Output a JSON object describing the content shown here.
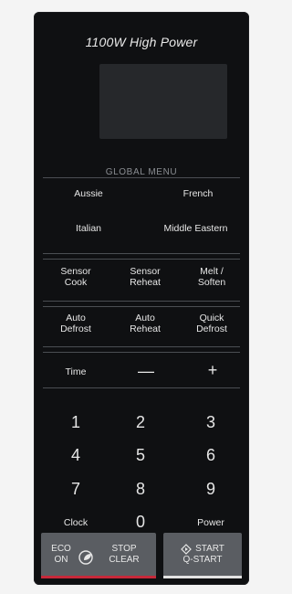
{
  "panel": {
    "power_label": "1100W High Power",
    "global_menu_title": "GLOBAL MENU",
    "global_menu_items": [
      "Aussie",
      "French",
      "Italian",
      "Middle Eastern"
    ],
    "sensor_row": [
      {
        "line1": "Sensor",
        "line2": "Cook"
      },
      {
        "line1": "Sensor",
        "line2": "Reheat"
      },
      {
        "line1": "Melt /",
        "line2": "Soften"
      }
    ],
    "defrost_row": [
      {
        "line1": "Auto",
        "line2": "Defrost"
      },
      {
        "line1": "Auto",
        "line2": "Reheat"
      },
      {
        "line1": "Quick",
        "line2": "Defrost"
      }
    ],
    "time_label": "Time",
    "minus_label": "—",
    "plus_label": "+",
    "keypad": {
      "digits_row1": [
        "1",
        "2",
        "3"
      ],
      "digits_row2": [
        "4",
        "5",
        "6"
      ],
      "digits_row3": [
        "7",
        "8",
        "9"
      ],
      "clock_label": "Clock",
      "zero": "0",
      "power_label": "Power"
    },
    "eco_stop": {
      "eco_line1": "ECO",
      "eco_line2": "ON",
      "stop_line1": "STOP",
      "stop_line2": "CLEAR"
    },
    "start": {
      "line1": "START",
      "line2": "Q-START"
    },
    "colors": {
      "panel_bg": "#0f1012",
      "button_bg": "#5a5d62",
      "red_accent": "#c6283a",
      "white_accent": "#e2e2e2"
    }
  }
}
